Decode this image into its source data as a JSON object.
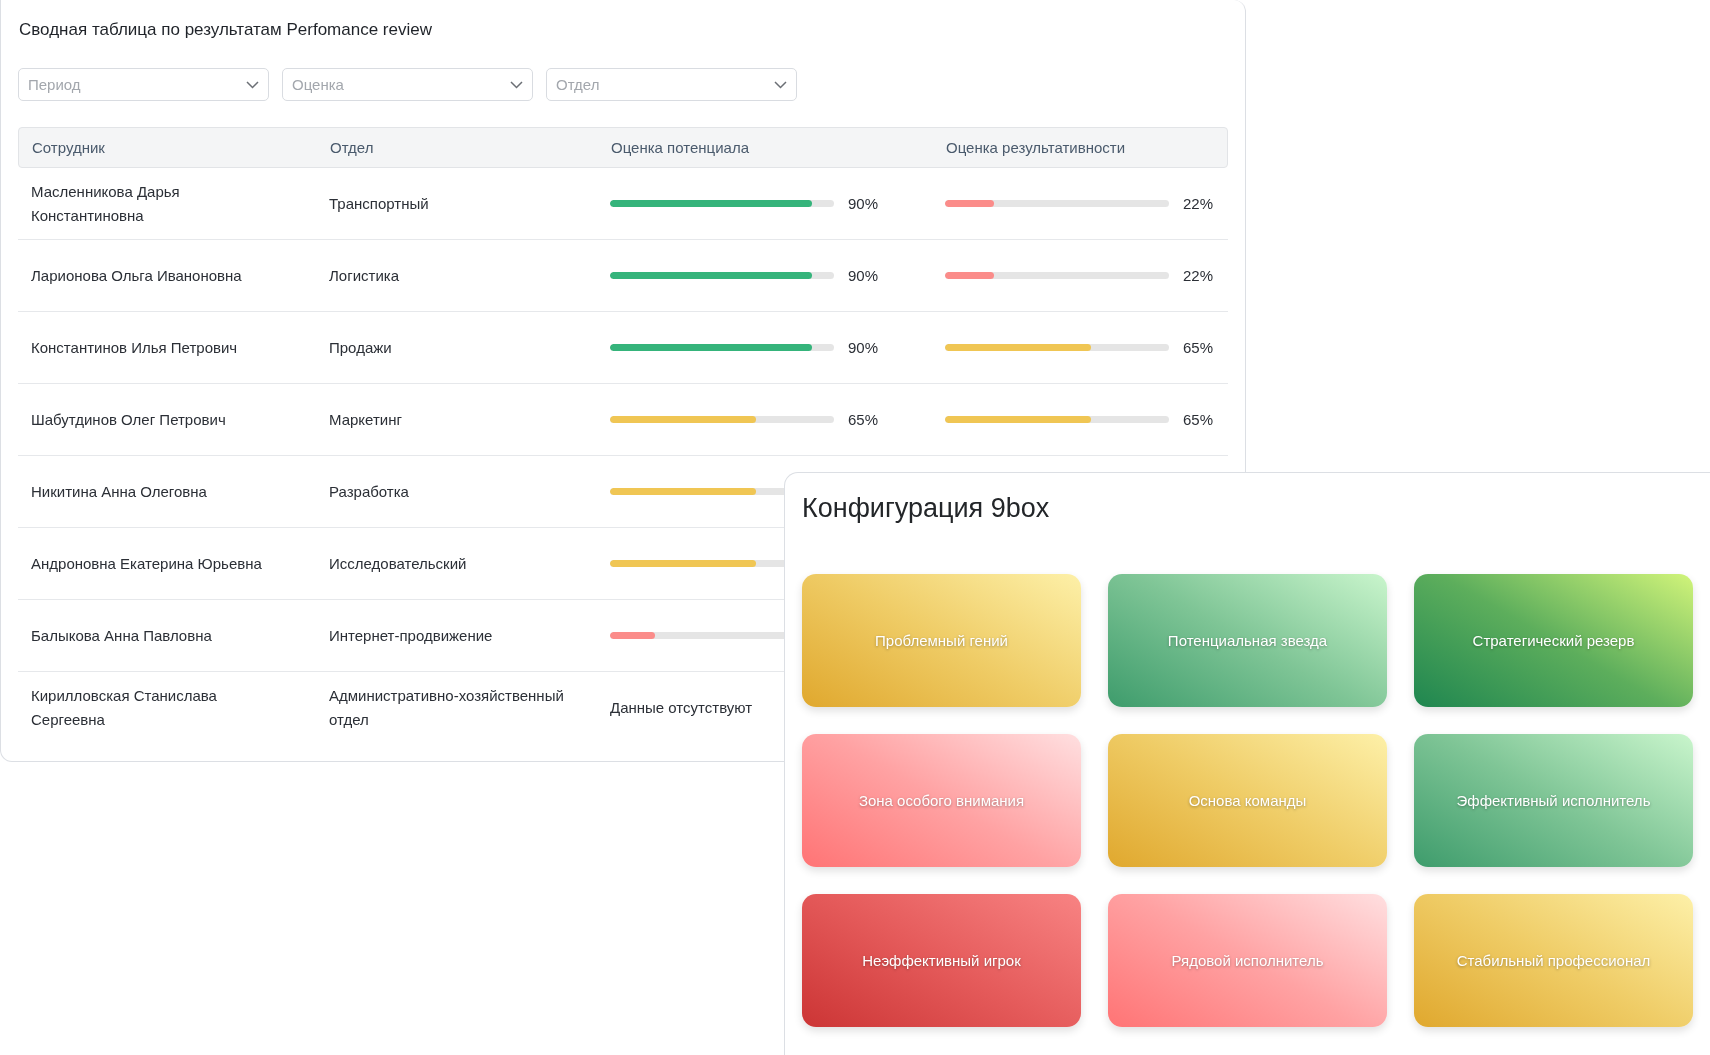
{
  "summary": {
    "title": "Сводная таблица по результатам Perfomance review",
    "filters": [
      {
        "placeholder": "Период"
      },
      {
        "placeholder": "Оценка"
      },
      {
        "placeholder": "Отдел"
      }
    ],
    "table": {
      "columns": [
        "Сотрудник",
        "Отдел",
        "Оценка потенциала",
        "Оценка результативности"
      ],
      "rows": [
        {
          "name": "Масленникова Дарья Константиновна",
          "department": "Транспортный",
          "potential": {
            "kind": "bar",
            "level": 0.9,
            "reading": "90%"
          },
          "result": {
            "kind": "bar",
            "level": 0.22,
            "reading": "22%"
          }
        },
        {
          "name": "Ларионова Ольга Иваноновна",
          "department": "Логистика",
          "potential": {
            "kind": "bar",
            "level": 0.9,
            "reading": "90%"
          },
          "result": {
            "kind": "bar",
            "level": 0.22,
            "reading": "22%"
          }
        },
        {
          "name": "Константинов Илья Петрович",
          "department": "Продажи",
          "potential": {
            "kind": "bar",
            "level": 0.9,
            "reading": "90%"
          },
          "result": {
            "kind": "bar",
            "level": 0.65,
            "reading": "65%"
          }
        },
        {
          "name": "Шабутдинов Олег Петрович",
          "department": "Маркетинг",
          "potential": {
            "kind": "bar",
            "level": 0.65,
            "reading": "65%"
          },
          "result": {
            "kind": "bar",
            "level": 0.65,
            "reading": "65%"
          }
        },
        {
          "name": "Никитина Анна Олеговна",
          "department": "Разработка",
          "potential": {
            "kind": "bar",
            "level": 0.65
          }
        },
        {
          "name": "Андроновна Екатерина Юрьевна",
          "department": "Исследовательский",
          "potential": {
            "kind": "bar",
            "level": 0.65
          }
        },
        {
          "name": "Балыкова Анна Павловна",
          "department": "Интернет-продвижение",
          "potential": {
            "kind": "bar",
            "level": 0.2
          }
        },
        {
          "name": "Кирилловская Станислава Сергеевна",
          "department": "Административно-хозяйственный отдел",
          "potential": {
            "kind": "note",
            "text": "Данные отсутствуют"
          }
        }
      ]
    }
  },
  "ninebox": {
    "title": "Конфигурация 9box",
    "tiles": [
      {
        "label": "Проблемный гений",
        "kind": "gold"
      },
      {
        "label": "Потенциальная звезда",
        "kind": "green"
      },
      {
        "label": "Стратегический резерв",
        "kind": "deep-green"
      },
      {
        "label": "Зона особого внимания",
        "kind": "pink"
      },
      {
        "label": "Основа команды",
        "kind": "gold"
      },
      {
        "label": "Эффективный исполнитель",
        "kind": "green"
      },
      {
        "label": "Неэффективный игрок",
        "kind": "red"
      },
      {
        "label": "Рядовой исполнитель",
        "kind": "pink"
      },
      {
        "label": "Стабильный профессионал",
        "kind": "gold"
      }
    ]
  }
}
